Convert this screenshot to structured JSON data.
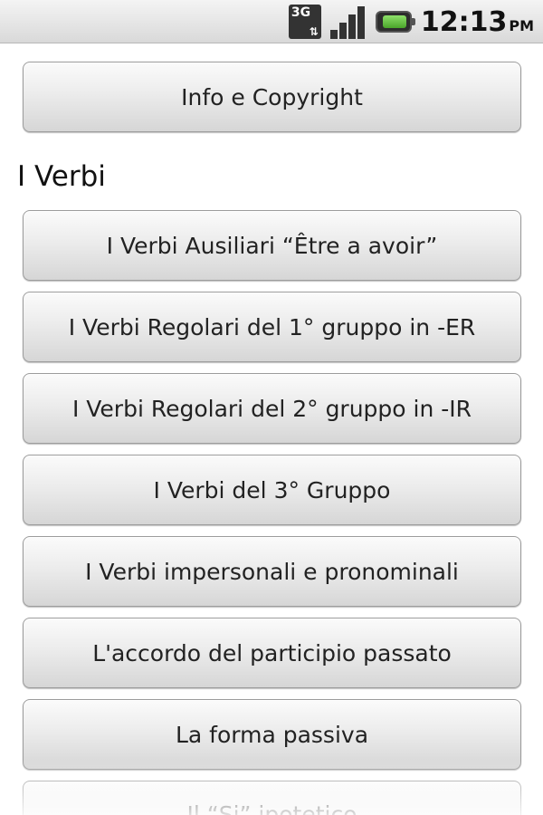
{
  "status_bar": {
    "network": "3G",
    "time": "12:13",
    "ampm": "PM",
    "icons": [
      "3g-data-icon",
      "signal-strength-icon",
      "battery-icon"
    ]
  },
  "top_button": {
    "label": "Info e Copyright"
  },
  "section": {
    "title": "I Verbi",
    "items": [
      {
        "label": "I Verbi Ausiliari “Être a avoir”"
      },
      {
        "label": "I Verbi Regolari del 1° gruppo in -ER"
      },
      {
        "label": "I Verbi Regolari del 2° gruppo in -IR"
      },
      {
        "label": "I Verbi del 3° Gruppo"
      },
      {
        "label": "I Verbi impersonali e pronominali"
      },
      {
        "label": "L'accordo del participio passato"
      },
      {
        "label": "La forma passiva"
      },
      {
        "label": "Il “Si” ipotetico"
      }
    ]
  }
}
